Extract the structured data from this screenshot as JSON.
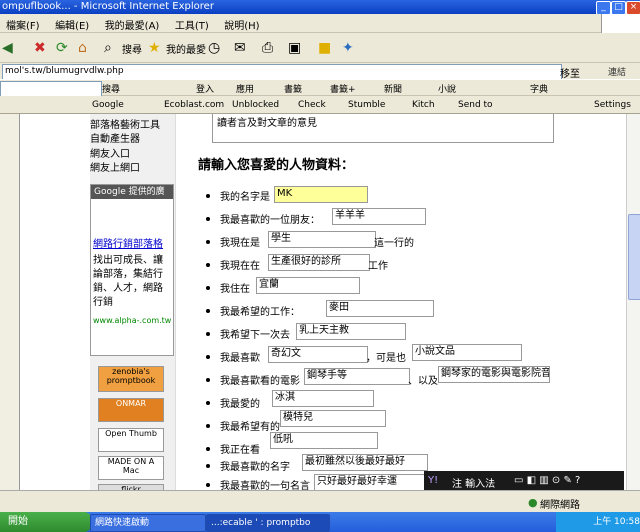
{
  "window": {
    "title": "ompuflbook... - Microsoft Internet Explorer"
  },
  "menu": {
    "items": [
      "檔案(F)",
      "編輯(E)",
      "我的最愛(A)",
      "工具(T)",
      "說明(H)"
    ]
  },
  "toolbar": {
    "search_label": "搜尋",
    "favorites_label": "我的最愛"
  },
  "address": {
    "value": "mol's.tw/blumugrvdlw.php",
    "go_label": "移至",
    "links_label": "連結"
  },
  "searchbar": {
    "items": [
      "搜尋",
      "登入",
      "應用",
      "書籤",
      "書籤+",
      "新聞",
      "小說",
      "字典"
    ]
  },
  "bookmarks": {
    "items": [
      "Google",
      "Ecoblast.com",
      "Unblocked",
      "Check",
      "Stumble",
      "Kitch",
      "Send to",
      "Settings"
    ]
  },
  "sidebar": {
    "links": [
      "部落格藝術工具",
      "自動產生器",
      "網友入口",
      "網友上網口"
    ],
    "google_head": "Google 提供的廣告",
    "ad_title": "網路行銷部落格",
    "ad_body": "找出可成長、讓論部落，集結行銷、人才，網路行銷",
    "ad_url": "www.alpha-.com.tw",
    "badges": [
      "zenobia's promptbook",
      "ONMAR",
      "Open Thumb",
      "MADE ON A Mac",
      "flickr"
    ]
  },
  "content": {
    "top_text": "讀者言及對文章的意見",
    "heading": "請輸入您喜愛的人物資料：",
    "questions": [
      {
        "label": "我的名字是",
        "value": "MK"
      },
      {
        "label": "我最喜歡的一位朋友：",
        "value": "羊羊羊"
      },
      {
        "label": "我現在是",
        "value": "學生",
        "suffix": "這一行的"
      },
      {
        "label": "我現在在",
        "value": "生產很好的診所",
        "suffix": "工作"
      },
      {
        "label": "我住在",
        "value": "宜蘭"
      },
      {
        "label": "我最希望的工作：",
        "value": "麥田"
      },
      {
        "label": "我希望下一次去",
        "value": "乳上天主教"
      },
      {
        "label": "我最喜歡",
        "value": "奇幻文",
        "suffix": "，可是也",
        "value2": "小說文品"
      },
      {
        "label": "我最喜歡看的電影",
        "value": "鋼琴手等",
        "suffix": "、以及",
        "value2": "鋼琴家的電影與電影院音樂"
      },
      {
        "label": "我最愛的",
        "value": "冰淇"
      },
      {
        "label": "我最希望有的",
        "value": "模特兒"
      },
      {
        "label": "我正在看",
        "value": "低吼"
      },
      {
        "label": "我最喜歡的名字",
        "value": "最初雖然以後最好最好"
      },
      {
        "label": "我最喜歡的一句名言",
        "value": "只好最好最好幸運"
      }
    ]
  },
  "status": {
    "text": "網際網路"
  },
  "yahoo": {
    "label": "注  輸入法"
  },
  "taskbar": {
    "start": "開始",
    "tasks": [
      "網路快速啟動",
      "...:ecable ' : promptbo"
    ],
    "time": "上午 10:58"
  }
}
